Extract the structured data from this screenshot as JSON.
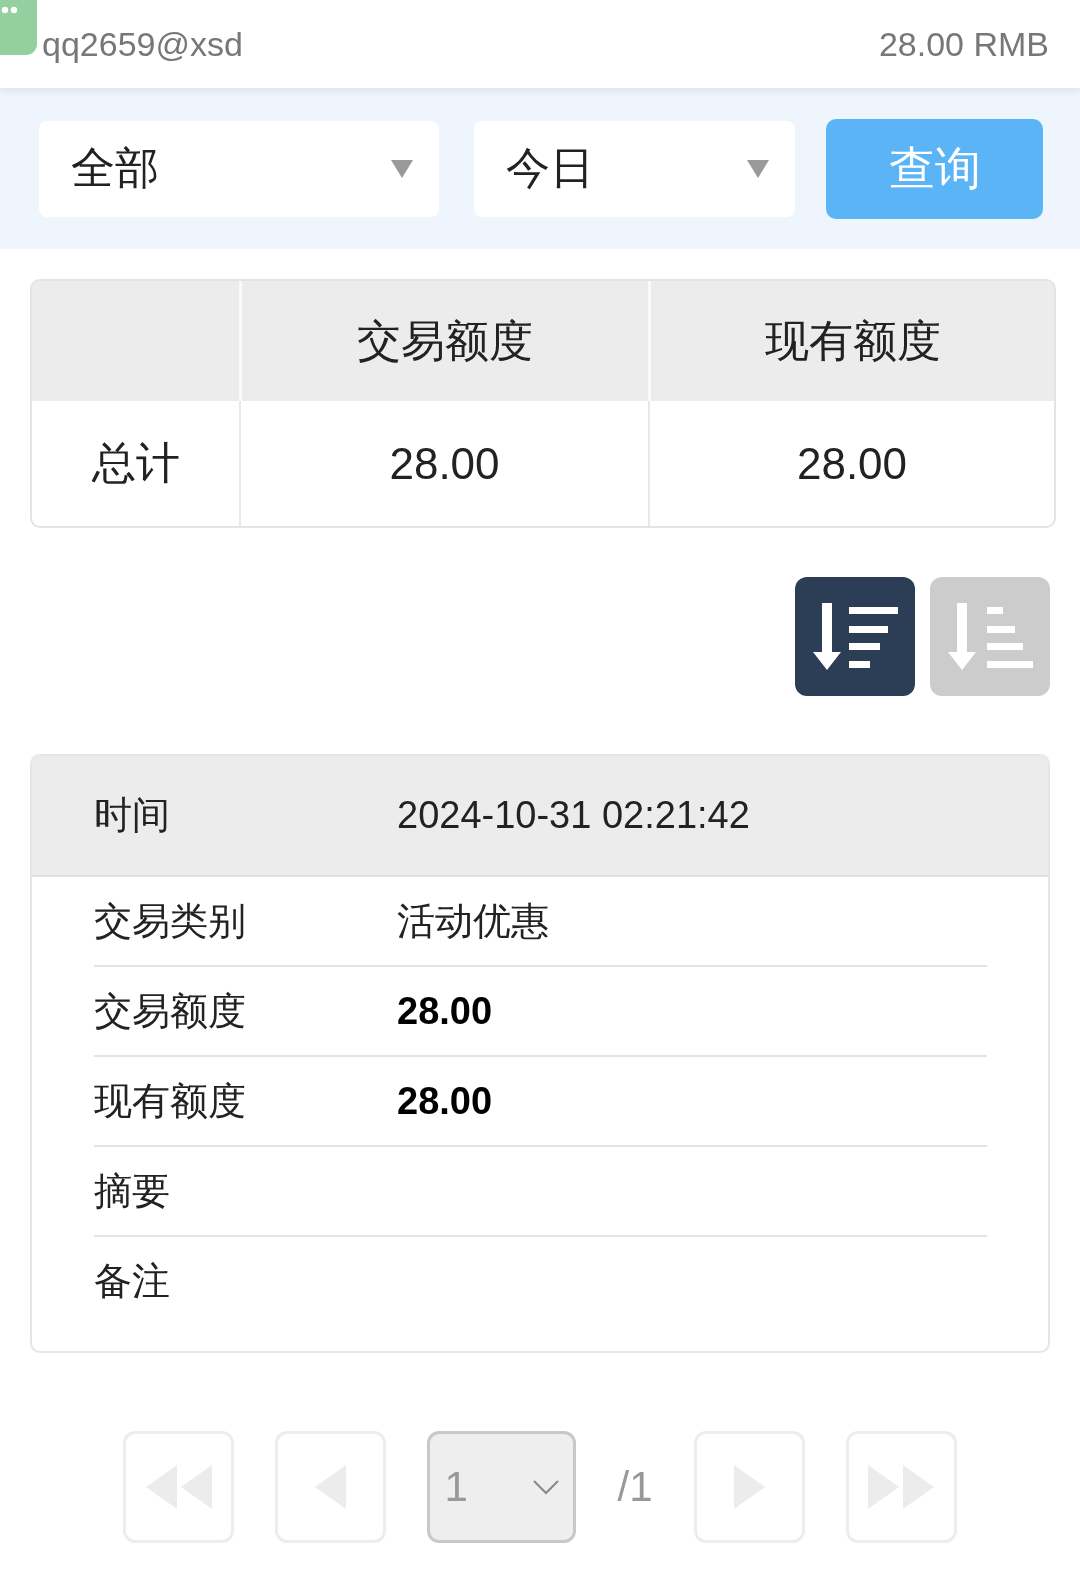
{
  "top_bar": {
    "username": "qq2659@xsd",
    "balance": "28.00 RMB"
  },
  "filters": {
    "dropdowns": [
      {
        "value": "全部"
      },
      {
        "value": "今日"
      }
    ],
    "query_button": "查询"
  },
  "summary_table": {
    "columns": [
      "交易额度",
      "现有额度"
    ],
    "rows": [
      {
        "label": "总计",
        "cells": [
          "28.00",
          "28.00"
        ]
      }
    ]
  },
  "sort_buttons": [
    {
      "kind": "descending",
      "selected": true
    },
    {
      "kind": "ascending",
      "selected": false
    }
  ],
  "record": {
    "header": {
      "label": "时间",
      "value": "2024-10-31 02:21:42"
    },
    "fields": [
      {
        "kind": "text",
        "label": "交易类别",
        "value": "活动优惠"
      },
      {
        "kind": "amount",
        "label": "交易额度",
        "value": "28.00"
      },
      {
        "kind": "amount",
        "label": "现有额度",
        "value": "28.00"
      },
      {
        "label": "摘要"
      },
      {
        "label": "备注"
      }
    ]
  },
  "pagination": {
    "items": [
      {
        "kind": "first",
        "disabled": true
      },
      {
        "kind": "previous",
        "disabled": true
      },
      {
        "kind": "page_select",
        "value": "1"
      },
      {
        "kind": "page_total",
        "text": "/1"
      },
      {
        "kind": "next",
        "disabled": true
      },
      {
        "kind": "last",
        "disabled": true
      }
    ]
  }
}
